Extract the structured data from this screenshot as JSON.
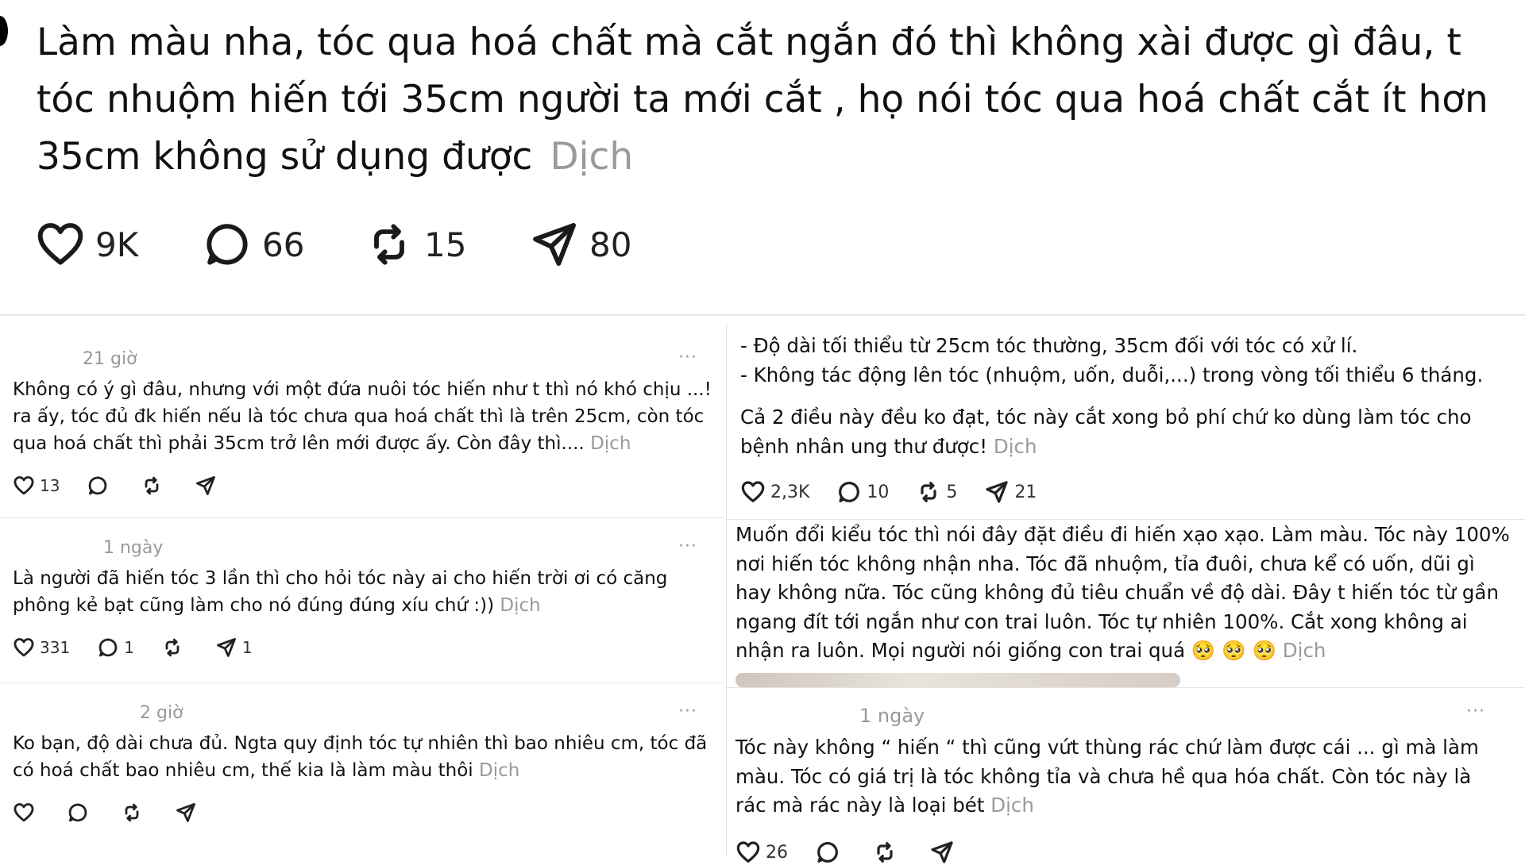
{
  "main_post": {
    "text": "Làm màu nha, tóc qua hoá chất mà cắt ngắn đó thì không xài được gì đâu, t tóc nhuộm hiến tới 35cm người ta mới cắt , họ nói tóc qua hoá chất cắt ít hơn 35cm không sử dụng được",
    "translate": "Dịch",
    "likes": "9K",
    "comments": "66",
    "reposts": "15",
    "shares": "80"
  },
  "left_comments": [
    {
      "time": "21 giờ",
      "more": "···",
      "text": "Không có ý gì đâu, nhưng với một đứa nuôi tóc hiến như t thì nó khó chịu ...! ra ấy, tóc đủ đk hiến nếu là tóc chưa qua hoá chất thì là trên 25cm, còn tóc qua hoá chất thì phải 35cm trở lên mới được ấy. Còn đây thì....",
      "translate": "Dịch",
      "likes": "13",
      "comments": "",
      "reposts": "",
      "shares": ""
    },
    {
      "time": "1 ngày",
      "more": "···",
      "text": "Là người đã hiến tóc 3 lần thì cho hỏi tóc này ai cho hiến trời ơi có căng phông kẻ bạt cũng làm cho nó đúng đúng xíu chứ :))",
      "translate": "Dịch",
      "likes": "331",
      "comments": "1",
      "reposts": "",
      "shares": "1"
    },
    {
      "time": "2 giờ",
      "more": "···",
      "text": "Ko bạn, độ dài chưa đủ. Ngta quy định tóc tự nhiên thì bao nhiêu cm, tóc đã có hoá chất bao nhiêu cm, thế kia là làm màu thôi",
      "translate": "Dịch",
      "likes": "",
      "comments": "",
      "reposts": "",
      "shares": ""
    }
  ],
  "right_comments": [
    {
      "lines": [
        "- Độ dài tối thiểu từ 25cm tóc thường, 35cm đối với tóc có xử lí.",
        "- Không tác động lên tóc (nhuộm, uốn, duỗi,...) trong vòng tối thiểu 6 tháng."
      ],
      "text": "Cả 2 điều này đều ko đạt, tóc này cắt xong bỏ phí chứ ko dùng làm tóc cho bệnh nhân ung thư được!",
      "translate": "Dịch",
      "likes": "2,3K",
      "comments": "10",
      "reposts": "5",
      "shares": "21"
    },
    {
      "text": "Muốn đổi kiểu tóc thì nói đây đặt điều đi hiến xạo xạo. Làm màu. Tóc này 100% nơi hiến tóc không nhận nha. Tóc đã nhuộm, tỉa đuôi, chưa kể có uốn, dũi gì hay không nữa. Tóc cũng không đủ tiêu chuẩn về độ dài. Đây t hiến tóc từ gần ngang đít tới ngắn như con trai luôn. Tóc tự nhiên 100%. Cắt xong không ai nhận ra luôn. Mọi người nói giống con trai quá",
      "emoji": "🥺 🥺 🥺",
      "translate": "Dịch"
    },
    {
      "time": "1 ngày",
      "more": "···",
      "text": "Tóc này không “ hiến “ thì cũng vứt thùng rác chứ làm được cái ... gì mà làm màu. Tóc có giá trị là tóc không tỉa và chưa hề qua hóa chất. Còn tóc này là rác mà rác này là loại bét",
      "translate": "Dịch",
      "likes": "26"
    }
  ]
}
